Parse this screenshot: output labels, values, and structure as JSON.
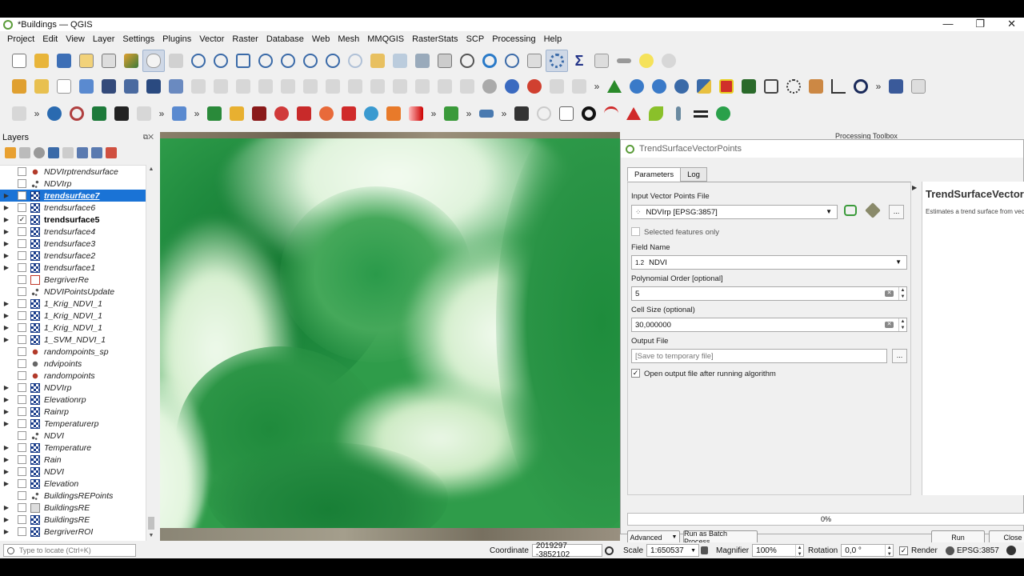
{
  "window": {
    "title": "*Buildings — QGIS",
    "controls": [
      "—",
      "❐",
      "✕"
    ]
  },
  "menu": [
    "Project",
    "Edit",
    "View",
    "Layer",
    "Settings",
    "Plugins",
    "Vector",
    "Raster",
    "Database",
    "Web",
    "Mesh",
    "MMQGIS",
    "RasterStats",
    "SCP",
    "Processing",
    "Help"
  ],
  "toolbar_more": "»",
  "layers_panel": {
    "title": "Layers",
    "items": [
      {
        "name": "NDVIrptrendsurface",
        "icon": "point",
        "checked": false,
        "expand": false,
        "style": "italic"
      },
      {
        "name": "NDVIrp",
        "icon": "dots",
        "checked": false,
        "expand": false,
        "style": "italic"
      },
      {
        "name": "trendsurface7",
        "icon": "raster",
        "checked": false,
        "expand": true,
        "style": "selected"
      },
      {
        "name": "trendsurface6",
        "icon": "raster",
        "checked": false,
        "expand": true,
        "style": "italic"
      },
      {
        "name": "trendsurface5",
        "icon": "raster",
        "checked": true,
        "expand": true,
        "style": "bold"
      },
      {
        "name": "trendsurface4",
        "icon": "raster",
        "checked": false,
        "expand": true,
        "style": "italic"
      },
      {
        "name": "trendsurface3",
        "icon": "raster",
        "checked": false,
        "expand": true,
        "style": "italic"
      },
      {
        "name": "trendsurface2",
        "icon": "raster",
        "checked": false,
        "expand": true,
        "style": "italic"
      },
      {
        "name": "trendsurface1",
        "icon": "raster",
        "checked": false,
        "expand": true,
        "style": "italic"
      },
      {
        "name": "BergriverRe",
        "icon": "poly",
        "checked": false,
        "expand": false,
        "style": "italic"
      },
      {
        "name": "NDVIPointsUpdate",
        "icon": "dots",
        "checked": false,
        "expand": false,
        "style": "italic"
      },
      {
        "name": "1_Krig_NDVI_1",
        "icon": "raster",
        "checked": false,
        "expand": true,
        "style": "italic"
      },
      {
        "name": "1_Krig_NDVI_1",
        "icon": "raster",
        "checked": false,
        "expand": true,
        "style": "italic"
      },
      {
        "name": "1_Krig_NDVI_1",
        "icon": "raster",
        "checked": false,
        "expand": true,
        "style": "italic"
      },
      {
        "name": "1_SVM_NDVI_1",
        "icon": "raster",
        "checked": false,
        "expand": true,
        "style": "italic"
      },
      {
        "name": "randompoints_sp",
        "icon": "point",
        "checked": false,
        "expand": false,
        "style": "italic"
      },
      {
        "name": "ndvipoints",
        "icon": "pointgrey",
        "checked": false,
        "expand": false,
        "style": "italic"
      },
      {
        "name": "randompoints",
        "icon": "point",
        "checked": false,
        "expand": false,
        "style": "italic"
      },
      {
        "name": "NDVIrp",
        "icon": "raster",
        "checked": false,
        "expand": true,
        "style": "italic"
      },
      {
        "name": "Elevationrp",
        "icon": "raster",
        "checked": false,
        "expand": true,
        "style": "italic"
      },
      {
        "name": "Rainrp",
        "icon": "raster",
        "checked": false,
        "expand": true,
        "style": "italic"
      },
      {
        "name": "Temperaturerp",
        "icon": "raster",
        "checked": false,
        "expand": true,
        "style": "italic"
      },
      {
        "name": "NDVI",
        "icon": "dots",
        "checked": false,
        "expand": false,
        "style": "italic"
      },
      {
        "name": "Temperature",
        "icon": "raster",
        "checked": false,
        "expand": true,
        "style": "italic"
      },
      {
        "name": "Rain",
        "icon": "raster",
        "checked": false,
        "expand": true,
        "style": "italic"
      },
      {
        "name": "NDVI",
        "icon": "raster",
        "checked": false,
        "expand": true,
        "style": "italic"
      },
      {
        "name": "Elevation",
        "icon": "raster",
        "checked": false,
        "expand": true,
        "style": "italic"
      },
      {
        "name": "BuildingsREPoints",
        "icon": "dots",
        "checked": false,
        "expand": false,
        "style": "italic"
      },
      {
        "name": "BuildingsRE",
        "icon": "polygrey",
        "checked": false,
        "expand": true,
        "style": "italic"
      },
      {
        "name": "BuildingsRE",
        "icon": "raster",
        "checked": false,
        "expand": true,
        "style": "italic"
      },
      {
        "name": "BergriverROI",
        "icon": "raster",
        "checked": false,
        "expand": true,
        "style": "italic"
      }
    ]
  },
  "locate": {
    "placeholder": "Type to locate (Ctrl+K)"
  },
  "processing_toolbox_label": "Processing Toolbox",
  "dialog": {
    "title": "TrendSurfaceVectorPoints",
    "tabs": [
      "Parameters",
      "Log"
    ],
    "input_label": "Input Vector Points File",
    "input_value": "NDVIrp [EPSG:3857]",
    "selected_only": "Selected features only",
    "field_label": "Field Name",
    "field_type": "1.2",
    "field_value": "NDVI",
    "poly_label": "Polynomial Order [optional]",
    "poly_value": "5",
    "cell_label": "Cell Size (optional)",
    "cell_value": "30,000000",
    "output_label": "Output File",
    "output_placeholder": "[Save to temporary file]",
    "open_output": "Open output file after running algorithm",
    "browse": "...",
    "help_title": "TrendSurfaceVectorPoints",
    "help_text": "Estimates a trend surface from vector points",
    "progress": "0%",
    "progress_value": 0,
    "advanced": "Advanced",
    "batch": "Run as Batch Process...",
    "run": "Run",
    "close": "Close"
  },
  "status": {
    "coordinate_label": "Coordinate",
    "coordinate": "2019297  -3852102",
    "scale_label": "Scale",
    "scale": "1:650537",
    "magnifier_label": "Magnifier",
    "magnifier": "100%",
    "rotation_label": "Rotation",
    "rotation": "0,0 °",
    "render_label": "Render",
    "crs": "EPSG:3857"
  }
}
